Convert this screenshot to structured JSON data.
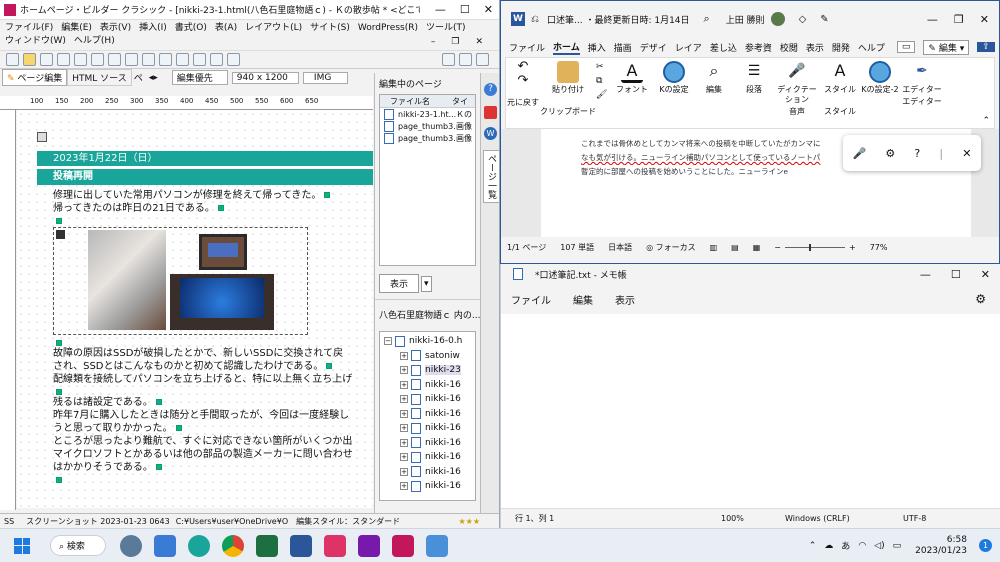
{
  "hpb": {
    "title": "ホームページ・ビルダー クラシック - [nikki-23-1.html(八色石里庭物語ｃ) - Ｋの散歩帖 * <どこでも...",
    "menu": [
      "ファイル(F)",
      "編集(E)",
      "表示(V)",
      "挿入(I)",
      "書式(O)",
      "表(A)",
      "レイアウト(L)",
      "サイト(S)",
      "WordPress(R)",
      "ツール(T)",
      "ウィンドウ(W)",
      "ヘルプ(H)"
    ],
    "tabs": {
      "page_edit": "ページ編集",
      "html_source": "HTML ソース",
      "preview": "ペ"
    },
    "editor_mode": "編集優先",
    "size": "940 x 1200",
    "img": "IMG",
    "ruler": [
      "100",
      "150",
      "200",
      "250",
      "300",
      "350",
      "400",
      "450",
      "500",
      "550",
      "600",
      "650"
    ],
    "content": {
      "date": "2023年1月22日（日）",
      "heading": "投稿再開",
      "p1": [
        "修理に出していた常用パソコンが修理を終えて帰ってきた。",
        "帰ってきたのは昨日の21日である。"
      ],
      "p2": [
        "故障の原因はSSDが破損したとかで、新しいSSDに交換されて戻",
        "され、SSDとはこんなものかと初めて認識したわけである。",
        "配線類を接続してパソコンを立ち上げると、特に以上無く立ち上げ"
      ],
      "p3": [
        "残るは諸設定である。",
        "昨年7月に購入したときは随分と手間取ったが、今回は一度経験し",
        "うと思って取りかかった。",
        "ところが思ったより難航で、すぐに対応できない箇所がいくつか出",
        "マイクロソフトとかあるいは他の部品の製造メーカーに問い合わせ",
        "はかかりそうである。"
      ]
    },
    "right_panel": {
      "title": "編集中のページ",
      "col_file": "ファイル名",
      "col_title": "タイ",
      "files": [
        {
          "name": "nikki-23-1.ht...",
          "title": "Ｋの"
        },
        {
          "name": "page_thumb3...",
          "title": "画像"
        },
        {
          "name": "page_thumb3...",
          "title": "画像"
        }
      ],
      "display_btn": "表示",
      "site_title": "八色石里庭物語ｃ 内の...",
      "tree": [
        "nikki-16-0.h",
        "satoniw",
        "nikki-23",
        "nikki-16",
        "nikki-16",
        "nikki-16",
        "nikki-16",
        "nikki-16",
        "nikki-16",
        "nikki-16",
        "nikki-16"
      ]
    },
    "side_tab": "ページ一覧",
    "status": {
      "ss": "SS",
      "desc": "スクリーンショット 2023-01-23 0643",
      "path": "C:¥Users¥user¥OneDrive¥O",
      "style": "編集スタイル：スタンダード",
      "stars": "★★★"
    }
  },
  "word": {
    "title": "口述筆... ・最終更新日時: 1月14日",
    "user": "上田 勝則",
    "menu": [
      "ファイル",
      "ホーム",
      "挿入",
      "描画",
      "デザイ",
      "レイア",
      "差し込",
      "参考資",
      "校閲",
      "表示",
      "開発",
      "ヘルプ"
    ],
    "edit_btn": "編集",
    "ribbon": {
      "undo": "元に戻す",
      "paste": "貼り付け",
      "clipboard": "クリップボード",
      "font": "フォント",
      "kset": "Kの設定",
      "edit": "編集",
      "paragraph": "段落",
      "dictation": "ディクテーション",
      "voice": "音声",
      "style_btn": "スタイル",
      "style_grp": "スタイル",
      "kset2": "Kの設定-2",
      "editor": "エディター",
      "editor_grp": "エディター"
    },
    "doc": [
      "これまでは骨休めとしてカンマ将来への投稿を中断していたがカンマに",
      "なも気が引ける。ニューライン補助パソコンとして使っているノートパ",
      "暫定的に部屋への投稿を始めいうことにした。ニューラインe"
    ],
    "status": {
      "page": "1/1 ページ",
      "words": "107 単語",
      "lang": "日本語",
      "focus": "フォーカス",
      "zoom": "77%"
    }
  },
  "notepad": {
    "title": "*口述筆記.txt - メモ帳",
    "menu": [
      "ファイル",
      "編集",
      "表示"
    ],
    "status": {
      "pos": "行 1、列 1",
      "zoom": "100%",
      "eol": "Windows (CRLF)",
      "enc": "UTF-8"
    }
  },
  "taskbar": {
    "search": "検索",
    "time": "6:58",
    "date": "2023/01/23",
    "ime": "あ",
    "badge": "1"
  },
  "colors": {
    "teal": "#1aa59a",
    "word": "#2b579a"
  }
}
